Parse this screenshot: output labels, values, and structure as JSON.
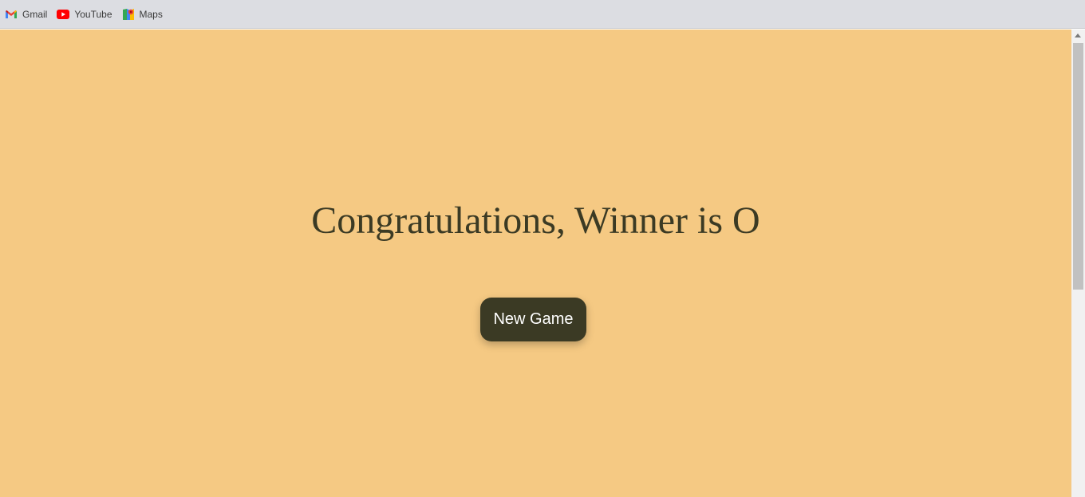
{
  "bookmarks": [
    {
      "label": "Gmail",
      "icon": "gmail-icon"
    },
    {
      "label": "YouTube",
      "icon": "youtube-icon"
    },
    {
      "label": "Maps",
      "icon": "maps-icon"
    }
  ],
  "game": {
    "result_text": "Congratulations, Winner is O",
    "new_game_label": "New Game"
  },
  "colors": {
    "page_background": "#f5c983",
    "accent_dark": "#3b3a24",
    "button_text": "#ffffff"
  }
}
